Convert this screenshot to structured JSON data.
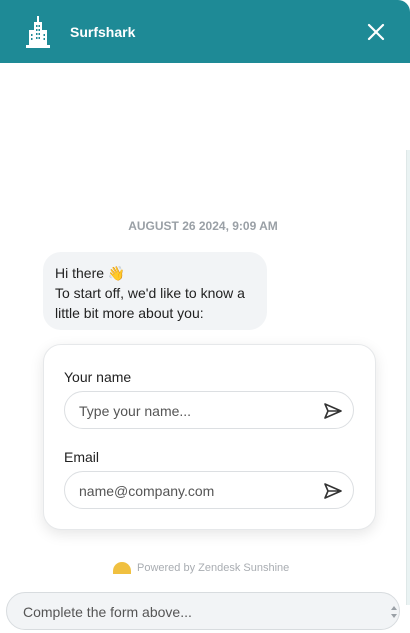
{
  "header": {
    "title": "Surfshark",
    "background": "#1e8a96",
    "logo_icon": "building-icon",
    "close_icon": "close-icon"
  },
  "chat": {
    "timestamp": "AUGUST 26 2024, 9:09 AM",
    "message": {
      "line1": "Hi there 👋",
      "line2": "To start off, we'd like to know a",
      "line3": "little bit more about you:"
    }
  },
  "form": {
    "name_label": "Your name",
    "name_placeholder": "Type your name...",
    "email_label": "Email",
    "email_placeholder": "name@company.com",
    "send_icon": "send-icon"
  },
  "footer": {
    "powered_by": "Powered by Zendesk Sunshine"
  },
  "composer": {
    "placeholder": "Complete the form above..."
  }
}
